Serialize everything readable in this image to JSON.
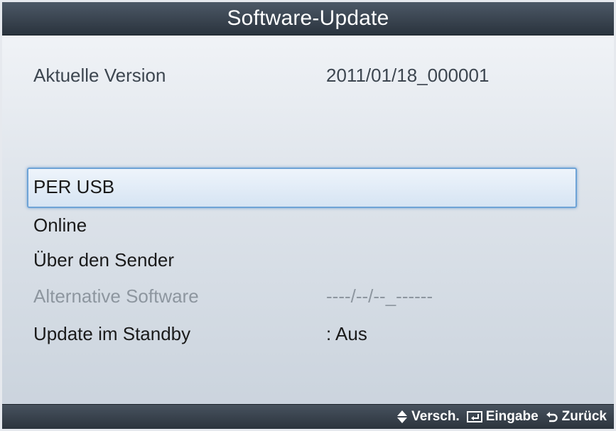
{
  "window": {
    "title": "Software-Update"
  },
  "info": {
    "current_version_label": "Aktuelle Version",
    "current_version_value": "2011/01/18_000001"
  },
  "menu": {
    "items": [
      {
        "label": "PER USB",
        "value": "",
        "selected": true,
        "enabled": true
      },
      {
        "label": "Online",
        "value": "",
        "selected": false,
        "enabled": true
      },
      {
        "label": "Über den Sender",
        "value": "",
        "selected": false,
        "enabled": true
      },
      {
        "label": "Alternative Software",
        "value": "----/--/--_------",
        "selected": false,
        "enabled": false
      },
      {
        "label": "Update im Standby",
        "value": ": Aus",
        "selected": false,
        "enabled": true
      }
    ]
  },
  "footer": {
    "hints": [
      {
        "icon": "up-down-arrows-icon",
        "label": "Versch."
      },
      {
        "icon": "enter-icon",
        "label": "Eingabe"
      },
      {
        "icon": "return-icon",
        "label": "Zurück"
      }
    ]
  },
  "colors": {
    "title_bar": "#2f3944",
    "selection_border": "#6ea3d6",
    "panel_background": "#dde3ea",
    "disabled_text": "#8d969f"
  }
}
